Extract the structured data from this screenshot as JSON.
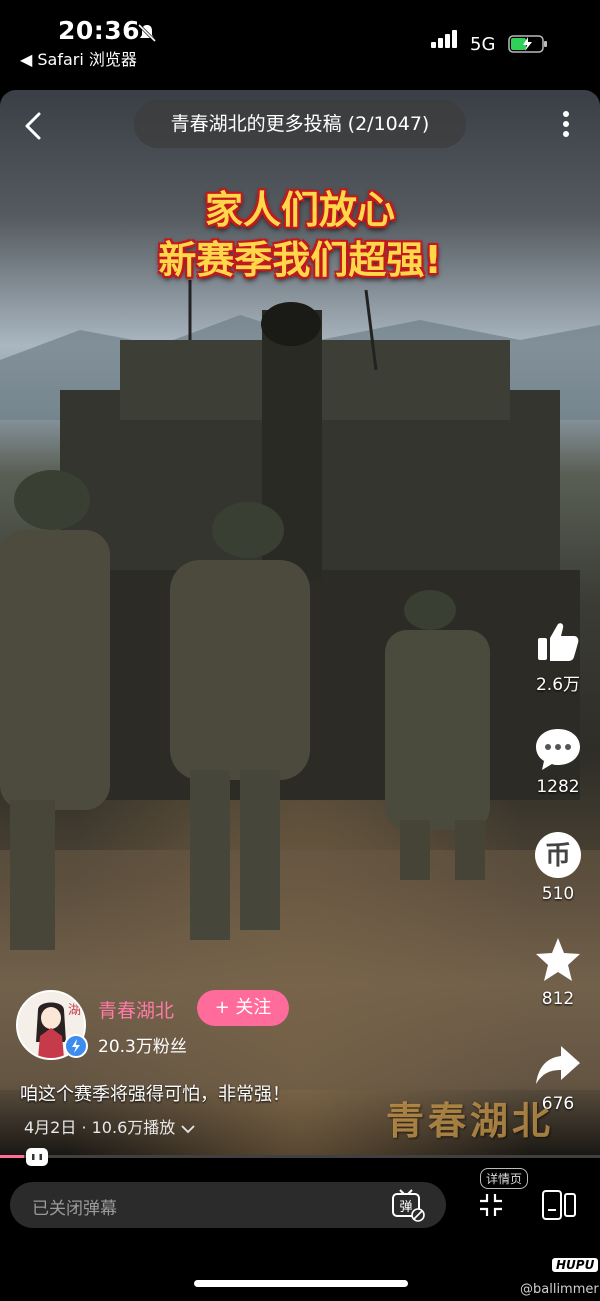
{
  "status_bar": {
    "time": "20:36",
    "back_app_label": "◀ Safari 浏览器",
    "network": "5G"
  },
  "top_bar": {
    "title": "青春湖北的更多投稿 (2/1047)"
  },
  "video": {
    "caption_lines": [
      "家人们放心",
      "新赛季我们超强!"
    ],
    "watermark": "青春湖北",
    "progress_fraction": 0.04
  },
  "actions": {
    "like_count": "2.6万",
    "comment_count": "1282",
    "coin_count": "510",
    "favorite_count": "812",
    "share_count": "676"
  },
  "author": {
    "name": "青春湖北",
    "follow_label": "+ 关注",
    "fans": "20.3万粉丝",
    "avatar_text": "湖北"
  },
  "post": {
    "description": "咱这个赛季将强得可怕，非常强！",
    "meta": "4月2日 · 10.6万播放"
  },
  "bottom_bar": {
    "danmaku_placeholder": "已关闭弹幕",
    "detail_label": "详情页",
    "brand": "HUPU",
    "handle": "@ballimmer"
  },
  "colors": {
    "accent_pink": "#ff6b9a",
    "caption_yellow": "#ffd84a",
    "caption_outline": "#c2191f"
  }
}
